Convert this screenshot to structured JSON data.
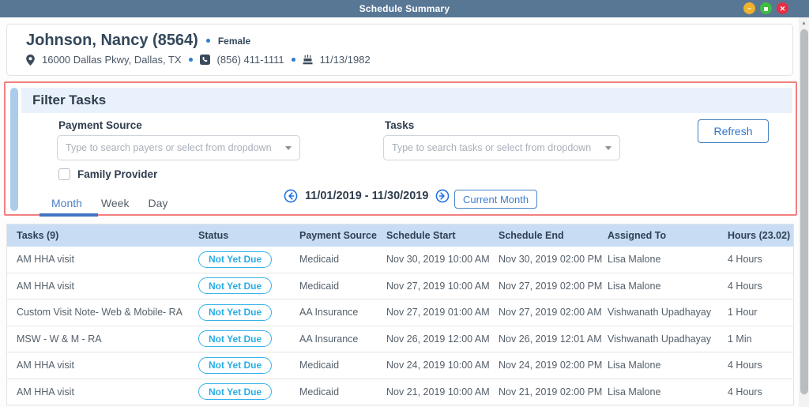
{
  "titlebar": {
    "title": "Schedule Summary",
    "minimize_glyph": "−",
    "close_glyph": "✕"
  },
  "patient": {
    "name": "Johnson, Nancy (8564)",
    "gender": "Female",
    "address": "16000 Dallas Pkwy, Dallas, TX",
    "phone": "(856) 411-1111",
    "dob": "11/13/1982"
  },
  "filter": {
    "title": "Filter Tasks",
    "payment_source_label": "Payment Source",
    "payment_source_placeholder": "Type to search payers or select from dropdown",
    "tasks_label": "Tasks",
    "tasks_placeholder": "Type to search tasks or select from dropdown",
    "refresh_label": "Refresh",
    "family_provider_label": "Family Provider",
    "family_provider_checked": false,
    "tabs": [
      {
        "label": "Month",
        "active": true
      },
      {
        "label": "Week",
        "active": false
      },
      {
        "label": "Day",
        "active": false
      }
    ],
    "date_range": "11/01/2019 - 11/30/2019",
    "current_month_label": "Current Month"
  },
  "table": {
    "columns": [
      "Tasks (9)",
      "Status",
      "Payment Source",
      "Schedule Start",
      "Schedule End",
      "Assigned To",
      "Hours (23.02)"
    ],
    "rows": [
      {
        "task": "AM HHA visit",
        "status": "Not Yet Due",
        "payment_source": "Medicaid",
        "start": "Nov 30, 2019 10:00 AM",
        "end": "Nov 30, 2019 02:00 PM",
        "assigned_to": "Lisa Malone",
        "hours": "4 Hours"
      },
      {
        "task": "AM HHA visit",
        "status": "Not Yet Due",
        "payment_source": "Medicaid",
        "start": "Nov 27, 2019 10:00 AM",
        "end": "Nov 27, 2019 02:00 PM",
        "assigned_to": "Lisa Malone",
        "hours": "4 Hours"
      },
      {
        "task": "Custom Visit Note- Web & Mobile- RA",
        "status": "Not Yet Due",
        "payment_source": "AA Insurance",
        "start": "Nov 27, 2019 01:00 AM",
        "end": "Nov 27, 2019 02:00 AM",
        "assigned_to": "Vishwanath Upadhayay",
        "hours": "1 Hour"
      },
      {
        "task": "MSW - W & M - RA",
        "status": "Not Yet Due",
        "payment_source": "AA Insurance",
        "start": "Nov 26, 2019 12:00 AM",
        "end": "Nov 26, 2019 12:01 AM",
        "assigned_to": "Vishwanath Upadhayay",
        "hours": "1 Min"
      },
      {
        "task": "AM HHA visit",
        "status": "Not Yet Due",
        "payment_source": "Medicaid",
        "start": "Nov 24, 2019 10:00 AM",
        "end": "Nov 24, 2019 02:00 PM",
        "assigned_to": "Lisa Malone",
        "hours": "4 Hours"
      },
      {
        "task": "AM HHA visit",
        "status": "Not Yet Due",
        "payment_source": "Medicaid",
        "start": "Nov 21, 2019 10:00 AM",
        "end": "Nov 21, 2019 02:00 PM",
        "assigned_to": "Lisa Malone",
        "hours": "4 Hours"
      }
    ]
  },
  "colors": {
    "titlebar_bg": "#587795",
    "accent_blue": "#4173c4",
    "status_pill": "#35b3e8",
    "filter_border": "#f28080",
    "table_header_bg": "#c8ddf3",
    "minimize_btn": "#eeb22c",
    "maximize_btn": "#3fbd3f",
    "close_btn": "#e62e45"
  }
}
